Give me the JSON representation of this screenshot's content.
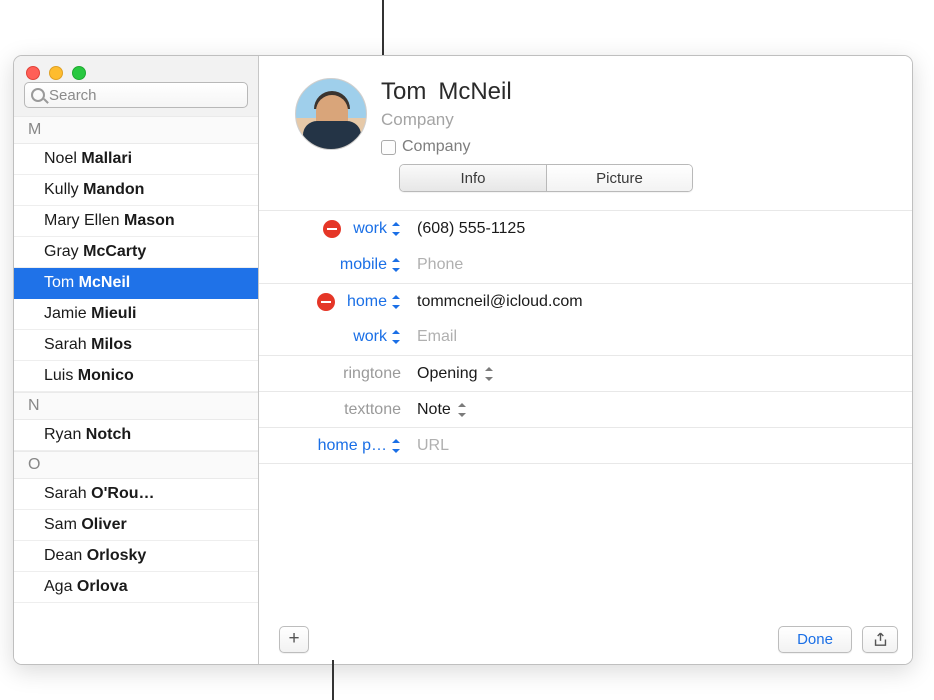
{
  "search": {
    "placeholder": "Search"
  },
  "sections": [
    {
      "letter": "M",
      "items": [
        {
          "first": "Noel",
          "last": "Mallari",
          "selected": false
        },
        {
          "first": "Kully",
          "last": "Mandon",
          "selected": false
        },
        {
          "first": "Mary Ellen",
          "last": "Mason",
          "selected": false
        },
        {
          "first": "Gray",
          "last": "McCarty",
          "selected": false
        },
        {
          "first": "Tom",
          "last": "McNeil",
          "selected": true
        },
        {
          "first": "Jamie",
          "last": "Mieuli",
          "selected": false
        },
        {
          "first": "Sarah",
          "last": "Milos",
          "selected": false
        },
        {
          "first": "Luis",
          "last": "Monico",
          "selected": false
        }
      ]
    },
    {
      "letter": "N",
      "items": [
        {
          "first": "Ryan",
          "last": "Notch",
          "selected": false
        }
      ]
    },
    {
      "letter": "O",
      "items": [
        {
          "first": "Sarah",
          "last": "O'Rou…",
          "selected": false
        },
        {
          "first": "Sam",
          "last": "Oliver",
          "selected": false
        },
        {
          "first": "Dean",
          "last": "Orlosky",
          "selected": false
        },
        {
          "first": "Aga",
          "last": "Orlova",
          "selected": false
        }
      ]
    }
  ],
  "card": {
    "first_name": "Tom",
    "last_name": "McNeil",
    "company_placeholder": "Company",
    "company_checkbox_label": "Company",
    "tabs": {
      "info": "Info",
      "picture": "Picture"
    }
  },
  "fields": {
    "phone_work": {
      "label": "work",
      "value": "(608) 555-1125"
    },
    "phone_mobile": {
      "label": "mobile",
      "placeholder": "Phone"
    },
    "email_home": {
      "label": "home",
      "value": "tommcneil@icloud.com"
    },
    "email_work": {
      "label": "work",
      "placeholder": "Email"
    },
    "ringtone": {
      "label": "ringtone",
      "value": "Opening"
    },
    "texttone": {
      "label": "texttone",
      "value": "Note"
    },
    "homepage": {
      "label": "home p…",
      "placeholder": "URL"
    }
  },
  "buttons": {
    "add": "+",
    "done": "Done"
  }
}
